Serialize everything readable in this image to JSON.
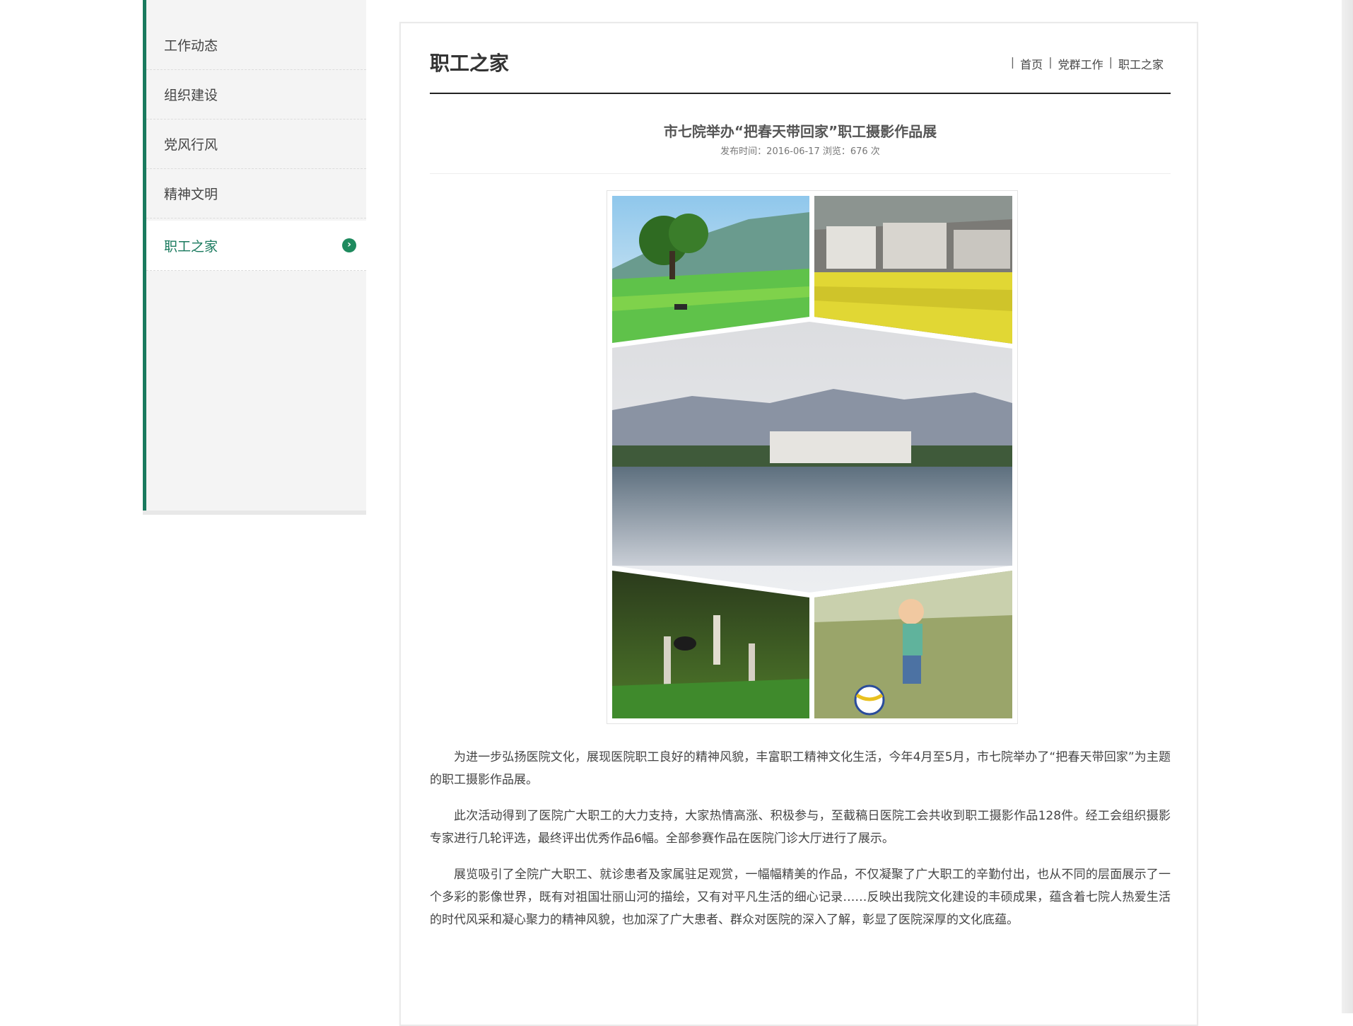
{
  "sidebar": {
    "items": [
      {
        "label": "工作动态",
        "active": false
      },
      {
        "label": "组织建设",
        "active": false
      },
      {
        "label": "党风行风",
        "active": false
      },
      {
        "label": "精神文明",
        "active": false
      },
      {
        "label": "职工之家",
        "active": true
      }
    ],
    "active_icon": "chevron-right-circle-icon",
    "accent_color": "#1a7a5e"
  },
  "header": {
    "title": "职工之家",
    "breadcrumb": [
      "首页",
      "党群工作",
      "职工之家"
    ]
  },
  "article": {
    "title": "市七院举办“把春天带回家”职工摄影作品展",
    "meta": "发布时间：2016-06-17 浏览：676 次",
    "paragraphs": [
      "为进一步弘扬医院文化，展现医院职工良好的精神风貌，丰富职工精神文化生活，今年4月至5月，市七院举办了“把春天带回家”为主题的职工摄影作品展。",
      "此次活动得到了医院广大职工的大力支持，大家热情高涨、积极参与，至截稿日医院工会共收到职工摄影作品128件。经工会组织摄影专家进行几轮评选，最终评出优秀作品6幅。全部参赛作品在医院门诊大厅进行了展示。",
      "展览吸引了全院广大职工、就诊患者及家属驻足观赏，一幅幅精美的作品，不仅凝聚了广大职工的辛勤付出，也从不同的层面展示了一个多彩的影像世界，既有对祖国壮丽山河的描绘，又有对平凡生活的细心记录……反映出我院文化建设的丰硕成果，蕴含着七院人热爱生活的时代风采和凝心聚力的精神风貌，也加深了广大患者、群众对医院的深入了解，彰显了医院深厚的文化底蕴。"
    ]
  }
}
